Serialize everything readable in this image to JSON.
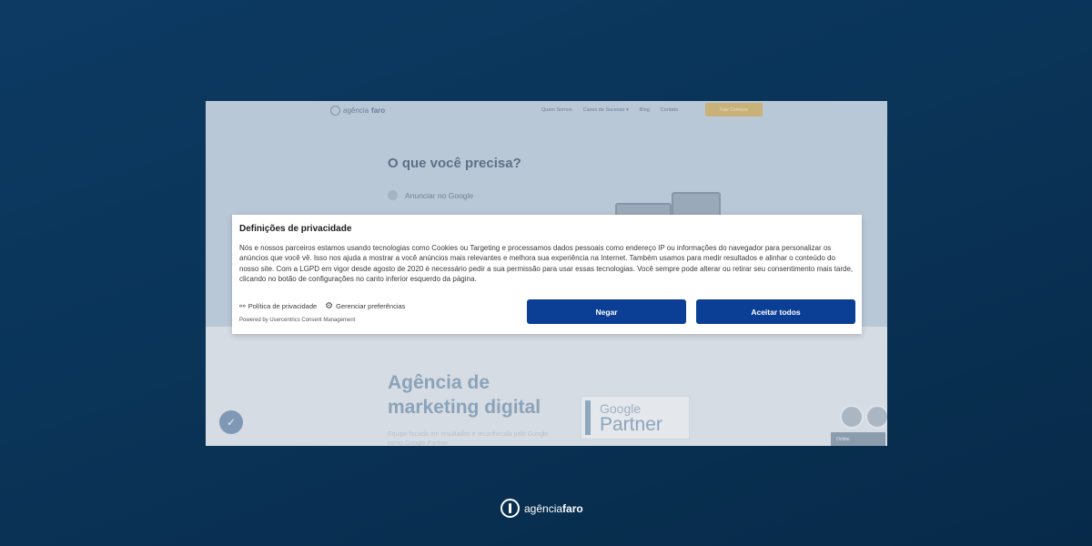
{
  "background_site": {
    "logo": {
      "prefix": "agência",
      "bold": "faro"
    },
    "nav": [
      "Quem Somos",
      "Cases de Sucesso",
      "Blog",
      "Contato"
    ],
    "nav_cta": "Fale Conosco",
    "hero_title": "O que você precisa?",
    "hero_item": "Anunciar no Google",
    "section_title_line1": "Agência de",
    "section_title_line2": "marketing digital",
    "section_subtitle": "Equipe focada em resultados e reconhecida pelo Google como Google Partner",
    "google_partner": {
      "google": "Google",
      "partner": "Partner"
    },
    "chat_status": "Online"
  },
  "consent_modal": {
    "title": "Definições de privacidade",
    "body": "Nós e nossos parceiros estamos usando tecnologias como Cookies ou Targeting e processamos dados pessoais como endereço IP ou informações do navegador para personalizar os anúncios que você vê. Isso nos ajuda a mostrar a você anúncios mais relevantes e melhora sua experiência na Internet. Também usamos para medir resultados e alinhar o conteúdo do nosso site. Com a LGPD em vigor desde agosto de 2020 é necessário pedir a sua permissão para usar essas tecnologias. Você sempre pode alterar ou retirar seu consentimento mais tarde, clicando no botão de configurações no canto inferior esquerdo da página.",
    "privacy_link": "Política de privacidade",
    "preferences_link": "Gerenciar preferências",
    "powered_by": "Powered by Usercentrics Consent Management",
    "deny_label": "Negar",
    "accept_label": "Aceitar todos"
  },
  "footer_brand": {
    "prefix": "agência",
    "bold": "faro"
  },
  "colors": {
    "button": "#0b3f96",
    "background": "#0a3458"
  }
}
